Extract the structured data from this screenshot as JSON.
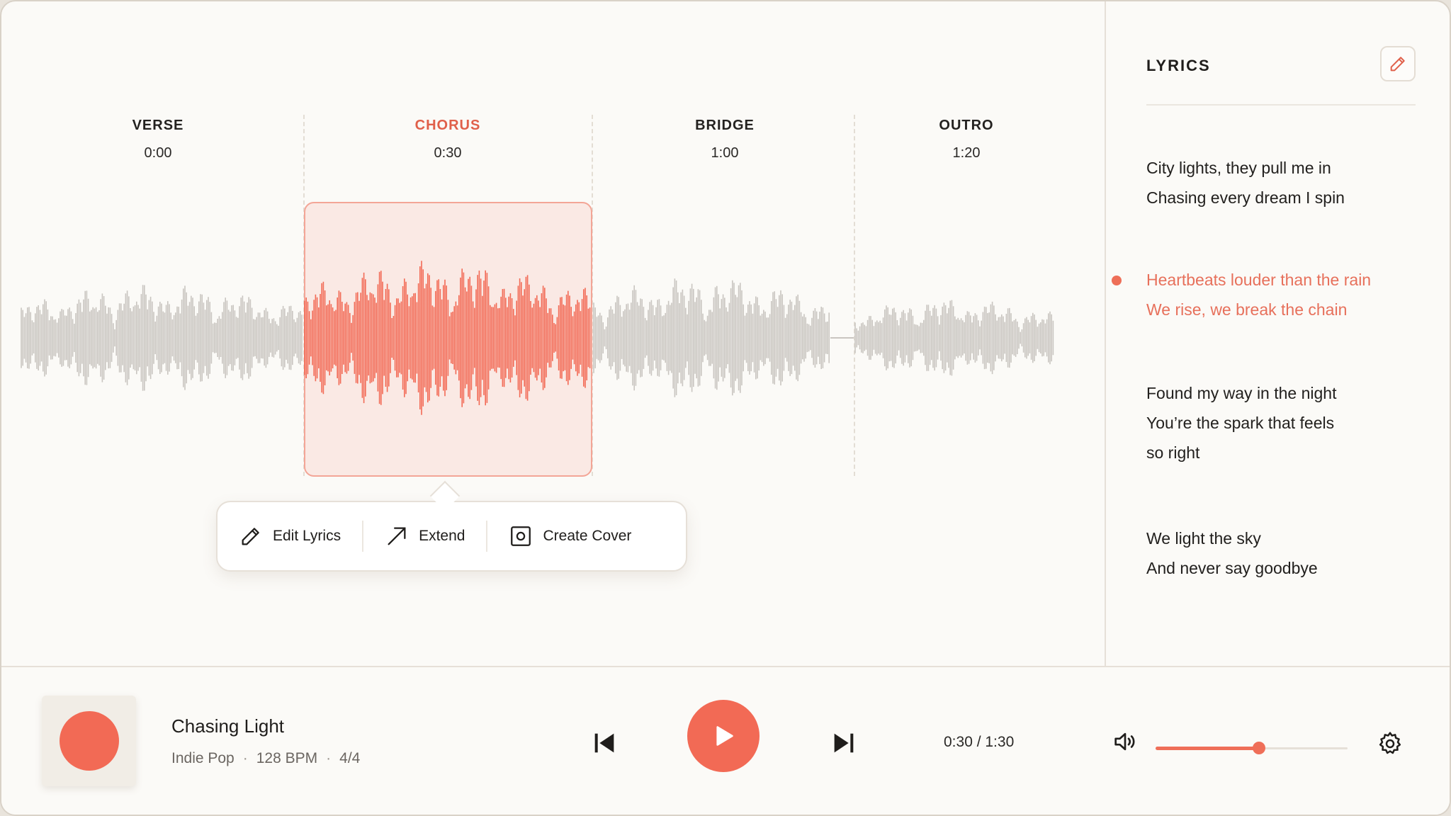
{
  "colors": {
    "accent": "#f26a55",
    "accent_text": "#e0604a",
    "waveform_gray": "#c9c5c0",
    "background": "#fbfaf7"
  },
  "sections": [
    {
      "label": "VERSE",
      "time": "0:00",
      "active": false
    },
    {
      "label": "CHORUS",
      "time": "0:30",
      "active": true
    },
    {
      "label": "BRIDGE",
      "time": "1:00",
      "active": false
    },
    {
      "label": "OUTRO",
      "time": "1:20",
      "active": false
    }
  ],
  "context_menu": {
    "edit_lyrics": {
      "label": "Edit Lyrics",
      "icon": "pencil-icon"
    },
    "extend": {
      "label": "Extend",
      "icon": "arrow-up-right-icon"
    },
    "create_cover": {
      "label": "Create Cover",
      "icon": "cover-frame-icon"
    }
  },
  "lyrics": {
    "title": "LYRICS",
    "edit_icon": "pencil-icon",
    "stanzas": [
      {
        "lines": [
          "City lights, they pull me in",
          "Chasing every dream I spin"
        ],
        "active": false
      },
      {
        "lines": [
          "Heartbeats louder than the rain",
          "We rise, we break the chain"
        ],
        "active": true
      },
      {
        "lines": [
          "Found my way in the night",
          "You’re the spark that feels",
          "so right"
        ],
        "active": false
      },
      {
        "lines": [
          "We light the sky",
          "And never say goodbye"
        ],
        "active": false
      }
    ]
  },
  "player": {
    "track_title": "Chasing Light",
    "genre": "Indie Pop",
    "bpm": "128 BPM",
    "time_signature": "4/4",
    "meta_separator": "·",
    "time_readout": "0:30 / 1:30",
    "volume_fraction": 0.54,
    "icons": {
      "prev": "skip-back-icon",
      "play": "play-icon",
      "next": "skip-forward-icon",
      "volume": "speaker-icon",
      "settings": "gear-icon"
    }
  }
}
